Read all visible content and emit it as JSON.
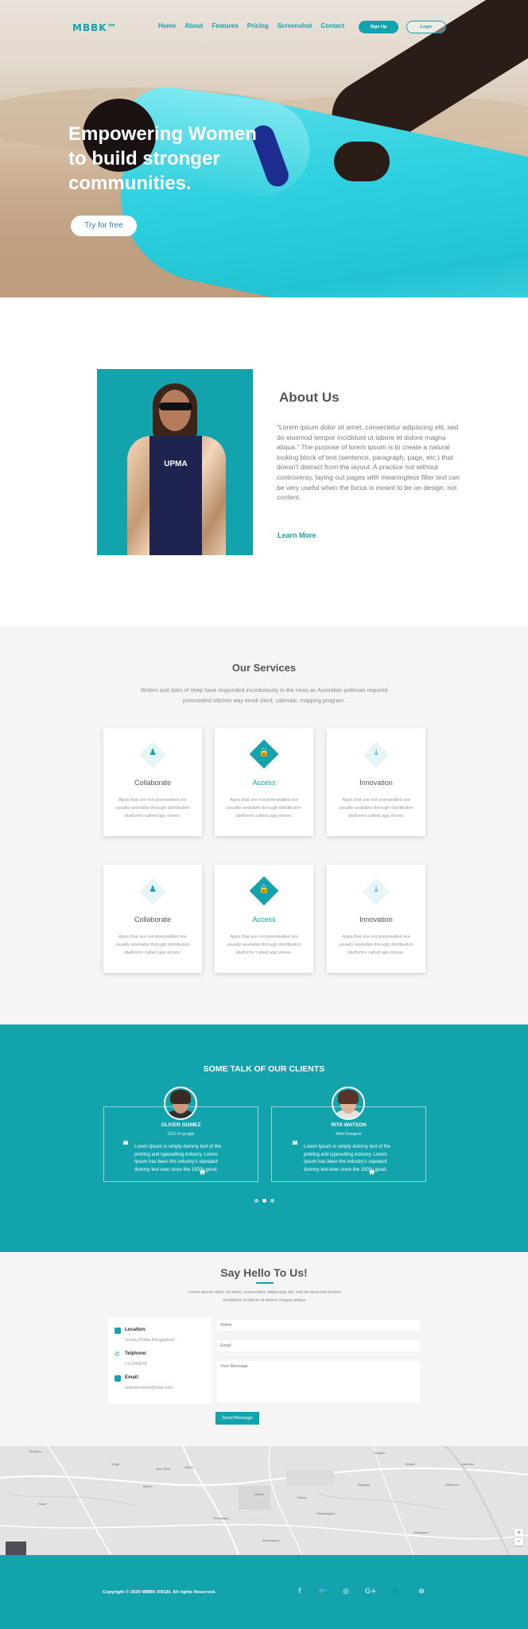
{
  "header": {
    "logo": "MBBK™",
    "nav": [
      "Home",
      "About",
      "Features",
      "Pricing",
      "Screenshot",
      "Contact"
    ],
    "signup_label": "Sign Up",
    "login_label": "Login"
  },
  "hero": {
    "title_lines": [
      "Empowering Women",
      "to build stronger",
      "communities."
    ],
    "cta_label": "Try for free"
  },
  "about": {
    "title": "About Us",
    "text": "“Lorem ipsum dolor sit amet, consectetur adipiscing elit, sed do eiusmod tempor incididunt ut labore et dolore magna aliqua.” The purpose of lorem ipsum is to create a natural looking block of text (sentence, paragraph, page, etc.) that doesn't distract from the layout. A practice not without controversy, laying out pages with meaningless filler text can be very useful when the focus is meant to be on design, not content.",
    "link_label": "Learn More",
    "image_text": "UPMA"
  },
  "services": {
    "title": "Our Services",
    "subtitle": "Writers and stars of Veep have responded incredulously to the news an Australian politician required preinstalled stitches way  email client, calendar, mapping program.",
    "cards": [
      {
        "title": "Collaborate",
        "icon": "collaborate-icon",
        "glyph": "♟",
        "active": false,
        "text": "Apps that are not preinstalled are usually available through distribution platforms called app stores."
      },
      {
        "title": "Access",
        "icon": "lock-icon",
        "glyph": "🔒",
        "active": true,
        "text": "Apps that are not preinstalled are usually available through distribution platforms called app stores."
      },
      {
        "title": "Innovation",
        "icon": "download-icon",
        "glyph": "⤓",
        "active": false,
        "text": "Apps that are not preinstalled are usually available through distribution platforms called app stores."
      },
      {
        "title": "Collaborate",
        "icon": "collaborate-icon",
        "glyph": "♟",
        "active": false,
        "text": "Apps that are not preinstalled are usually available through distribution platforms called app stores."
      },
      {
        "title": "Access",
        "icon": "lock-icon",
        "glyph": "🔒",
        "active": true,
        "text": "Apps that are not preinstalled are usually available through distribution platforms called app stores."
      },
      {
        "title": "Innovation",
        "icon": "download-icon",
        "glyph": "⤓",
        "active": false,
        "text": "Apps that are not preinstalled are usually available through distribution platforms called app stores."
      }
    ]
  },
  "clients": {
    "title": "SOME TALK OF OUR CLIENTS",
    "testimonials": [
      {
        "name": "OLIVER GOMEZ",
        "role": "CEO of google",
        "quote": "Lorem Ipsum is simply dummy text of the printing and typesetting industry. Lorem Ipsum has been the industry's standard dummy text ever since the 1500s,good."
      },
      {
        "name": "RITA WATSON",
        "role": "Web Designer",
        "quote": "Lorem Ipsum is simply dummy text of the printing and typesetting industry. Lorem Ipsum has been the industry's standard dummy text ever since the 1500s,good."
      }
    ],
    "pager": {
      "count": 3,
      "active": 2
    }
  },
  "contact": {
    "title": "Say Hello To Us!",
    "subtitle": "Lorem ipsum dolor sit amet, consectetur adipiscing elit, sed do eiusmod tempor incididunt ut labore et dolore magna aliqua.",
    "location_label": "Location:",
    "location_value": "Jurain,Dhaka Bangladesh",
    "phone_label": "Telphone:",
    "phone_value": "+12345678",
    "email_label": "Email:",
    "email_value": "websitename@mail.com",
    "name_placeholder": "Name",
    "email_placeholder": "Email",
    "message_placeholder": "Your Message",
    "send_label": "Send Message"
  },
  "map": {
    "labels": [
      "Ghazipur",
      "Tongi",
      "Uttara",
      "Gazipur",
      "Mirpur",
      "New Town",
      "Dhaka",
      "Narayanganj",
      "Savar",
      "Keraniganj",
      "Rupganj",
      "Demra",
      "Araihazar",
      "Sonargaon",
      "Munshiganj",
      "Bhulta",
      "Kanchan"
    ]
  },
  "footer": {
    "copyright": "Copyright © 2020 MBBK DSGN. All rights Reserved.",
    "social": [
      {
        "icon": "facebook-icon",
        "glyph": "f"
      },
      {
        "icon": "twitter-icon",
        "glyph": "🐦"
      },
      {
        "icon": "instagram-icon",
        "glyph": "◎"
      },
      {
        "icon": "google-plus-icon",
        "glyph": "G+"
      },
      {
        "icon": "linkedin-icon",
        "glyph": "in"
      },
      {
        "icon": "dribbble-icon",
        "glyph": "⊛"
      }
    ]
  }
}
